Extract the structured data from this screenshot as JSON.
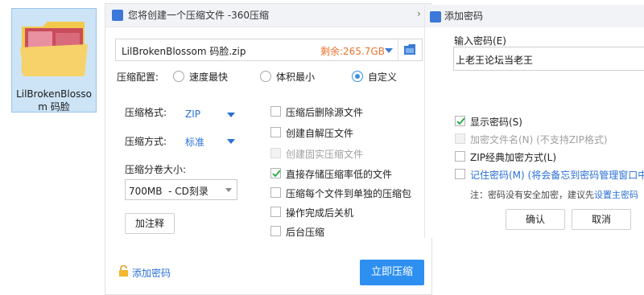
{
  "desktop": {
    "file_label": "LilBrokenBlossom 码脸"
  },
  "compress_dialog": {
    "title": "您将创建一个压缩文件 -360压缩",
    "path_value": "LilBrokenBlossom 码脸.zip",
    "free_space": "剩余:265.7GB",
    "config_label": "压缩配置:",
    "config_options": [
      "速度最快",
      "体积最小",
      "自定义"
    ],
    "selected_config": "自定义",
    "format_label": "压缩格式:",
    "format_value": "ZIP",
    "method_label": "压缩方式:",
    "method_value": "标准",
    "split_label": "压缩分卷大小:",
    "split_value": "700MB  - CD刻录",
    "comment_button": "加注释",
    "options": [
      {
        "label": "压缩后删除源文件",
        "checked": false,
        "disabled": false
      },
      {
        "label": "创建自解压文件",
        "checked": false,
        "disabled": false
      },
      {
        "label": "创建固实压缩文件",
        "checked": false,
        "disabled": true
      },
      {
        "label": "直接存储压缩率低的文件",
        "checked": true,
        "disabled": false
      },
      {
        "label": "压缩每个文件到单独的压缩包",
        "checked": false,
        "disabled": false
      },
      {
        "label": "操作完成后关机",
        "checked": false,
        "disabled": false
      },
      {
        "label": "后台压缩",
        "checked": false,
        "disabled": false
      }
    ],
    "add_password_link": "添加密码",
    "compress_button": "立即压缩"
  },
  "password_dialog": {
    "title": "添加密码",
    "input_label": "输入密码(E)",
    "password_value": "上老王论坛当老王",
    "options": [
      {
        "label": "显示密码(S)",
        "checked": true,
        "disabled": false
      },
      {
        "label": "加密文件名(N) (不支持ZIP格式)",
        "checked": false,
        "disabled": true
      },
      {
        "label": "ZIP经典加密方式(L)",
        "checked": false,
        "disabled": false
      },
      {
        "label": "记住密码(M) (将会备忘到密码管理窗口中)",
        "checked": false,
        "disabled": false
      }
    ],
    "note_prefix": "注：密码没有安全加密，建议先",
    "note_link": "设置主密码",
    "ok_button": "确认",
    "cancel_button": "取消"
  },
  "colors": {
    "accent": "#2d8ff0",
    "link": "#2a6fd6",
    "warning": "#e8732c",
    "check": "#27a844"
  }
}
